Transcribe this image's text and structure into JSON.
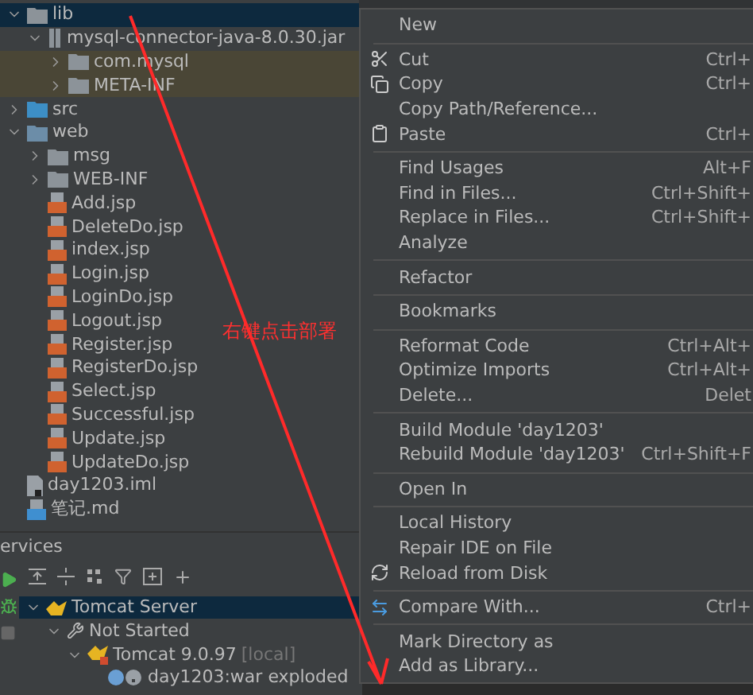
{
  "project_tree": [
    {
      "label": "lib",
      "kind": "folder",
      "expanded": true,
      "selected": true,
      "highlighted": false,
      "children": [
        {
          "label": "mysql-connector-java-8.0.30.jar",
          "kind": "jar",
          "expanded": true,
          "selected": false,
          "highlighted": false,
          "children": [
            {
              "label": "com.mysql",
              "kind": "folder",
              "expanded": false,
              "selected": false,
              "highlighted": true
            },
            {
              "label": "META-INF",
              "kind": "folder",
              "expanded": false,
              "selected": false,
              "highlighted": true
            }
          ]
        }
      ]
    },
    {
      "label": "src",
      "kind": "source",
      "expanded": false,
      "selected": false,
      "highlighted": false
    },
    {
      "label": "web",
      "kind": "web",
      "expanded": true,
      "selected": false,
      "highlighted": false,
      "children": [
        {
          "label": "msg",
          "kind": "folder",
          "expanded": false,
          "selected": false,
          "highlighted": false
        },
        {
          "label": "WEB-INF",
          "kind": "folder",
          "expanded": false,
          "selected": false,
          "highlighted": false
        },
        {
          "label": "Add.jsp",
          "kind": "jsp",
          "selected": false,
          "highlighted": false
        },
        {
          "label": "DeleteDo.jsp",
          "kind": "jsp",
          "selected": false,
          "highlighted": false
        },
        {
          "label": "index.jsp",
          "kind": "jsp",
          "selected": false,
          "highlighted": false
        },
        {
          "label": "Login.jsp",
          "kind": "jsp",
          "selected": false,
          "highlighted": false
        },
        {
          "label": "LoginDo.jsp",
          "kind": "jsp",
          "selected": false,
          "highlighted": false
        },
        {
          "label": "Logout.jsp",
          "kind": "jsp",
          "selected": false,
          "highlighted": false
        },
        {
          "label": "Register.jsp",
          "kind": "jsp",
          "selected": false,
          "highlighted": false
        },
        {
          "label": "RegisterDo.jsp",
          "kind": "jsp",
          "selected": false,
          "highlighted": false
        },
        {
          "label": "Select.jsp",
          "kind": "jsp",
          "selected": false,
          "highlighted": false
        },
        {
          "label": "Successful.jsp",
          "kind": "jsp",
          "selected": false,
          "highlighted": false
        },
        {
          "label": "Update.jsp",
          "kind": "jsp",
          "selected": false,
          "highlighted": false
        },
        {
          "label": "UpdateDo.jsp",
          "kind": "jsp",
          "selected": false,
          "highlighted": false
        }
      ]
    },
    {
      "label": "day1203.iml",
      "kind": "iml",
      "selected": false,
      "highlighted": false
    },
    {
      "label": "笔记.md",
      "kind": "md",
      "selected": false,
      "highlighted": false
    }
  ],
  "services": {
    "title": "ervices",
    "tree": [
      {
        "label": "Tomcat Server",
        "kind": "server",
        "expanded": true,
        "selected": true,
        "children": [
          {
            "label": "Not Started",
            "kind": "group",
            "expanded": true,
            "selected": false,
            "children": [
              {
                "label": "Tomcat 9.0.97",
                "note": "[local]",
                "kind": "tomcat",
                "expanded": true,
                "selected": false,
                "children": [
                  {
                    "label": "day1203:war exploded",
                    "kind": "artifact",
                    "selected": false
                  }
                ]
              }
            ]
          }
        ]
      }
    ]
  },
  "annotation": {
    "text": "右键点击部署"
  },
  "context_menu": [
    [
      {
        "label": "New"
      }
    ],
    [
      {
        "label": "Cut",
        "shortcut": "Ctrl+",
        "kind": "cut"
      },
      {
        "label": "Copy",
        "shortcut": "Ctrl+",
        "kind": "copy"
      },
      {
        "label": "Copy Path/Reference..."
      },
      {
        "label": "Paste",
        "shortcut": "Ctrl+",
        "kind": "paste"
      }
    ],
    [
      {
        "label": "Find Usages",
        "shortcut": "Alt+F"
      },
      {
        "label": "Find in Files...",
        "shortcut": "Ctrl+Shift+"
      },
      {
        "label": "Replace in Files...",
        "shortcut": "Ctrl+Shift+"
      },
      {
        "label": "Analyze"
      }
    ],
    [
      {
        "label": "Refactor"
      }
    ],
    [
      {
        "label": "Bookmarks"
      }
    ],
    [
      {
        "label": "Reformat Code",
        "shortcut": "Ctrl+Alt+"
      },
      {
        "label": "Optimize Imports",
        "shortcut": "Ctrl+Alt+"
      },
      {
        "label": "Delete...",
        "shortcut": "Delet"
      }
    ],
    [
      {
        "label": "Build Module 'day1203'"
      },
      {
        "label": "Rebuild Module 'day1203'",
        "shortcut": "Ctrl+Shift+F"
      }
    ],
    [
      {
        "label": "Open In"
      }
    ],
    [
      {
        "label": "Local History"
      },
      {
        "label": "Repair IDE on File"
      },
      {
        "label": "Reload from Disk",
        "kind": "reload"
      }
    ],
    [
      {
        "label": "Compare With...",
        "shortcut": "Ctrl+",
        "kind": "compare"
      }
    ],
    [
      {
        "label": "Mark Directory as"
      },
      {
        "label": "Add as Library..."
      }
    ]
  ]
}
